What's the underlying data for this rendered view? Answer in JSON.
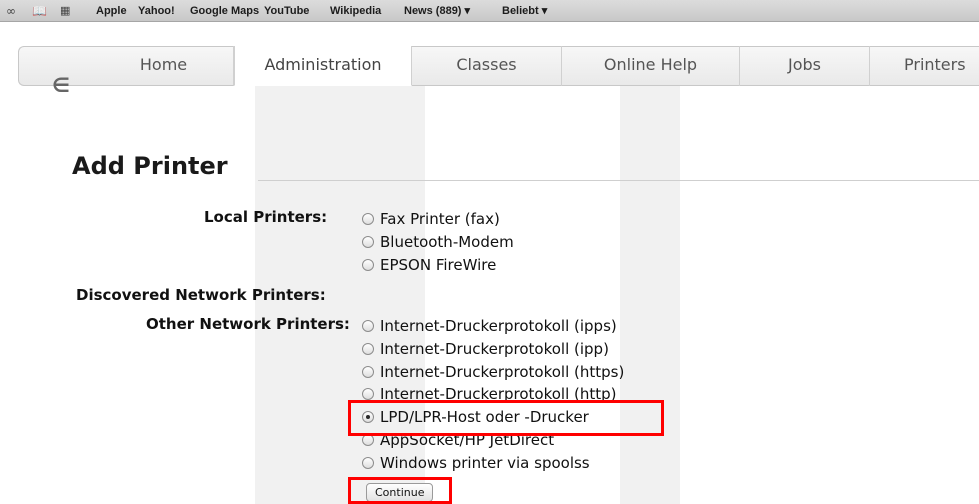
{
  "bookmarks_bar": {
    "icons": [
      "reading-list-icon",
      "bookmarks-book-icon",
      "top-sites-grid-icon"
    ],
    "items": [
      {
        "label": "Apple"
      },
      {
        "label": "Yahoo!"
      },
      {
        "label": "Google Maps"
      },
      {
        "label": "YouTube"
      },
      {
        "label": "Wikipedia"
      },
      {
        "label": "News (889) ▾"
      },
      {
        "label": "Beliebt ▾"
      }
    ]
  },
  "nav": {
    "logo_icon": "cups-logo-icon",
    "tabs": [
      {
        "label": "Home",
        "active": false
      },
      {
        "label": "Administration",
        "active": true
      },
      {
        "label": "Classes",
        "active": false
      },
      {
        "label": "Online Help",
        "active": false
      },
      {
        "label": "Jobs",
        "active": false
      },
      {
        "label": "Printers",
        "active": false
      }
    ]
  },
  "page": {
    "title": "Add Printer",
    "groups": [
      {
        "label": "Local Printers:",
        "options": [
          {
            "label": "Fax Printer (fax)",
            "checked": false
          },
          {
            "label": "Bluetooth-Modem",
            "checked": false
          },
          {
            "label": "EPSON FireWire",
            "checked": false
          }
        ]
      },
      {
        "label": "Discovered Network Printers:",
        "options": []
      },
      {
        "label": "Other Network Printers:",
        "options": [
          {
            "label": "Internet-Druckerprotokoll (ipps)",
            "checked": false
          },
          {
            "label": "Internet-Druckerprotokoll (ipp)",
            "checked": false
          },
          {
            "label": "Internet-Druckerprotokoll (https)",
            "checked": false
          },
          {
            "label": "Internet-Druckerprotokoll (http)",
            "checked": false
          },
          {
            "label": "LPD/LPR-Host oder -Drucker",
            "checked": true
          },
          {
            "label": "AppSocket/HP JetDirect",
            "checked": false
          },
          {
            "label": "Windows printer via spoolss",
            "checked": false
          }
        ]
      }
    ],
    "continue_label": "Continue"
  },
  "colors": {
    "highlight": "#ff0000",
    "text": "#111111",
    "tab_background": "#eeeeee"
  }
}
